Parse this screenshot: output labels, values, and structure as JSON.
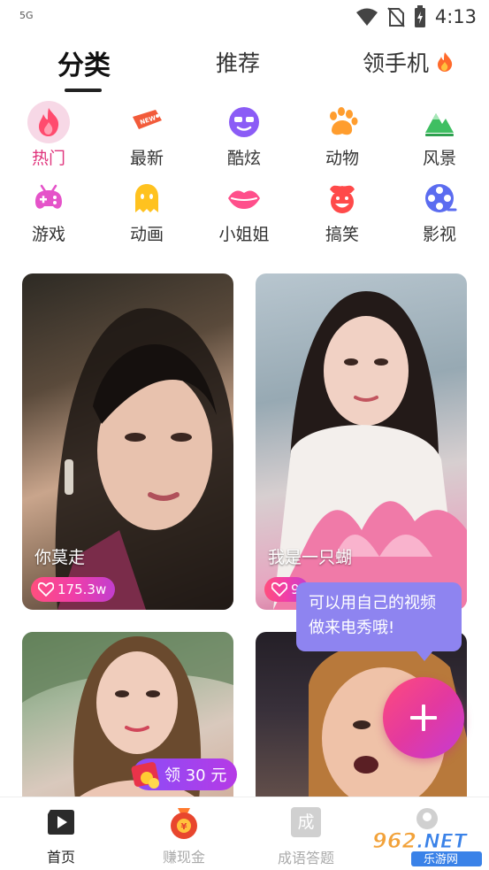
{
  "status_bar": {
    "network": "5G",
    "time": "4:13"
  },
  "top_tabs": [
    {
      "label": "分类",
      "active": true
    },
    {
      "label": "推荐",
      "active": false
    },
    {
      "label": "领手机",
      "active": false
    }
  ],
  "categories": [
    {
      "label": "热门",
      "icon": "fire-icon",
      "color": "#ff4b6e",
      "active": true
    },
    {
      "label": "最新",
      "icon": "new-tag-icon",
      "color": "#f25b3a",
      "active": false
    },
    {
      "label": "酷炫",
      "icon": "cool-face-icon",
      "color": "#8b5cf6",
      "active": false
    },
    {
      "label": "动物",
      "icon": "paw-icon",
      "color": "#ff9d2e",
      "active": false
    },
    {
      "label": "风景",
      "icon": "mountain-icon",
      "color": "#3fbf62",
      "active": false
    },
    {
      "label": "游戏",
      "icon": "gamepad-icon",
      "color": "#e553c9",
      "active": false
    },
    {
      "label": "动画",
      "icon": "ghost-icon",
      "color": "#ffc21f",
      "active": false
    },
    {
      "label": "小姐姐",
      "icon": "lips-icon",
      "color": "#ff4f8b",
      "active": false
    },
    {
      "label": "搞笑",
      "icon": "clown-icon",
      "color": "#ff4a4a",
      "active": false
    },
    {
      "label": "影视",
      "icon": "film-reel-icon",
      "color": "#5b6cf0",
      "active": false
    }
  ],
  "videos": [
    {
      "title": "你莫走",
      "likes": "175.3w"
    },
    {
      "title": "我是一只蝴",
      "likes": "9"
    },
    {
      "title": "",
      "likes": ""
    },
    {
      "title": "",
      "likes": ""
    }
  ],
  "coupon": {
    "label": "领 30 元"
  },
  "tooltip": {
    "line1": "可以用自己的视频",
    "line2": "做来电秀哦!"
  },
  "fab": {
    "icon": "plus-icon"
  },
  "bottom_nav": [
    {
      "label": "首页",
      "active": true,
      "icon": "play-home-icon"
    },
    {
      "label": "赚现金",
      "active": false,
      "icon": "money-bag-icon"
    },
    {
      "label": "成语答题",
      "active": false,
      "icon": "idiom-icon",
      "icon_text": "成"
    },
    {
      "label": "",
      "active": false,
      "icon": "profile-icon"
    }
  ],
  "watermark": {
    "text": "962.NET",
    "sub": "乐游网"
  }
}
